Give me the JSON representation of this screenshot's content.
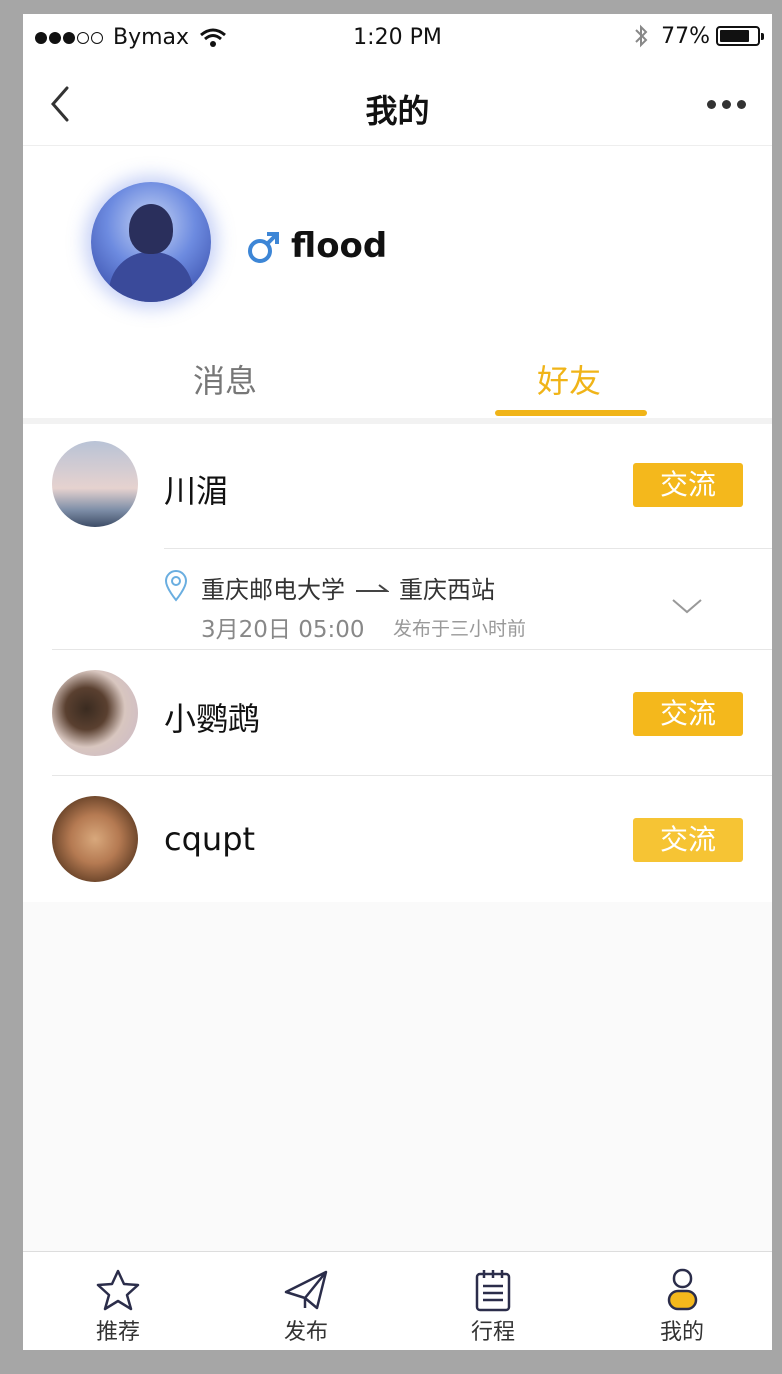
{
  "status_bar": {
    "carrier": "Bymax",
    "time": "1:20 PM",
    "battery": "77%",
    "icons": [
      "signal-dots",
      "wifi-icon",
      "bluetooth-icon",
      "battery-icon"
    ]
  },
  "nav": {
    "title": "我的",
    "icons": [
      "back-chevron-icon",
      "more-dots-icon"
    ]
  },
  "profile": {
    "username": "flood",
    "gender_icon": "male-symbol-icon",
    "gender_color": "#3d86d6"
  },
  "tabs": [
    {
      "label": "消息",
      "active": false
    },
    {
      "label": "好友",
      "active": true
    }
  ],
  "accent_color": "#f0b418",
  "friends": [
    {
      "name": "川湄",
      "action_label": "交流",
      "trip": {
        "from": "重庆邮电大学",
        "to": "重庆西站",
        "time": "3月20日 05:00",
        "posted": "发布于三小时前"
      }
    },
    {
      "name": "小鹦鹉",
      "action_label": "交流"
    },
    {
      "name": "cqupt",
      "action_label": "交流"
    }
  ],
  "tab_bar": [
    {
      "label": "推荐",
      "icon": "star-icon"
    },
    {
      "label": "发布",
      "icon": "paper-plane-icon"
    },
    {
      "label": "行程",
      "icon": "notepad-icon"
    },
    {
      "label": "我的",
      "icon": "person-icon"
    }
  ]
}
